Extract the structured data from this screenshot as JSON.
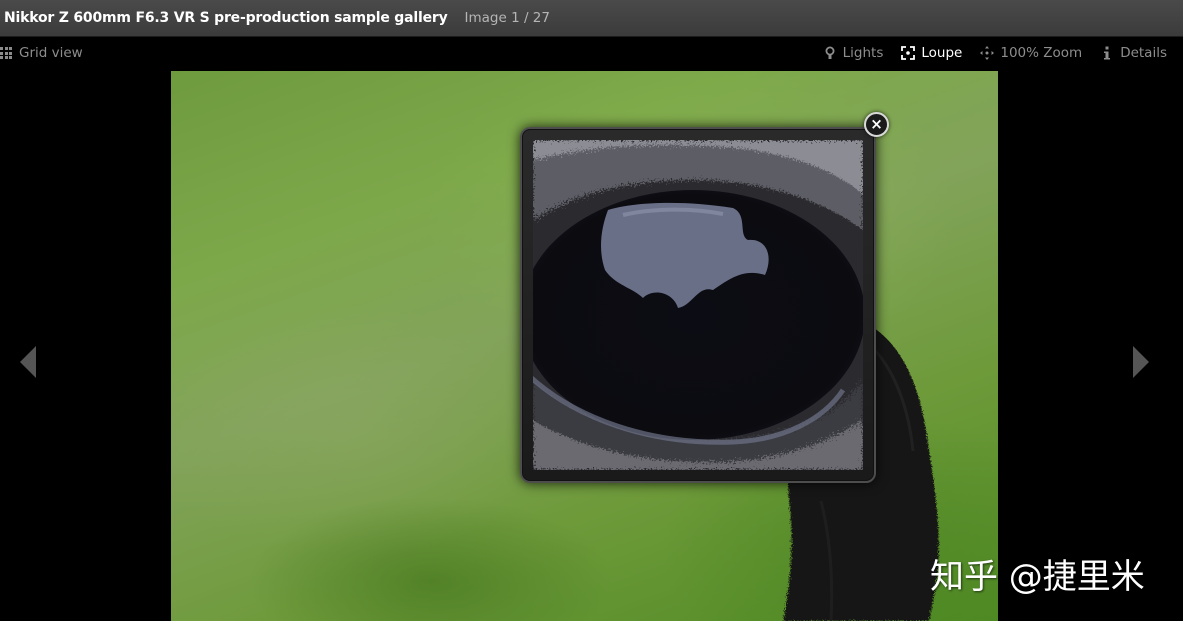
{
  "header": {
    "title": "Nikkor Z 600mm F6.3 VR S pre-production sample gallery",
    "counter": "Image 1 / 27"
  },
  "toolbar": {
    "grid_view": {
      "label": "Grid view",
      "icon": "grid-icon"
    },
    "items": [
      {
        "label": "Lights",
        "icon": "bulb-icon",
        "active": false
      },
      {
        "label": "Loupe",
        "icon": "loupe-icon",
        "active": true
      },
      {
        "label": "100% Zoom",
        "icon": "move-icon",
        "active": false
      },
      {
        "label": "Details",
        "icon": "info-icon",
        "active": false
      }
    ]
  },
  "navigation": {
    "prev_icon": "chevron-left-icon",
    "next_icon": "chevron-right-icon"
  },
  "loupe": {
    "close_label": "×",
    "close_icon": "close-icon"
  },
  "watermark": {
    "text": "知乎 @捷里米"
  },
  "colors": {
    "titlebar": "#444444",
    "background": "#000000",
    "active_text": "#ffffff",
    "inactive_text": "#8d8d8d"
  }
}
